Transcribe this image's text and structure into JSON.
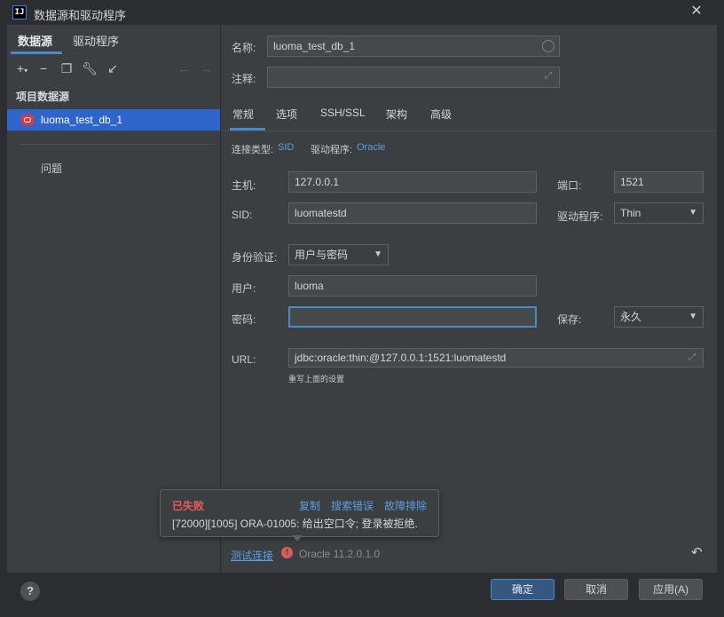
{
  "window": {
    "title": "数据源和驱动程序",
    "app_icon": "IJ"
  },
  "left_panel": {
    "tabs": [
      "数据源",
      "驱动程序"
    ],
    "section_title": "项目数据源",
    "datasource_item": "luoma_test_db_1",
    "problems": "问题"
  },
  "form": {
    "name_label": "名称:",
    "name_value": "luoma_test_db_1",
    "comment_label": "注释:",
    "comment_value": "",
    "tabs": [
      "常规",
      "选项",
      "SSH/SSL",
      "架构",
      "高级"
    ],
    "conn_type_label": "连接类型:",
    "conn_type_value": "SID",
    "driver_label": "驱动程序:",
    "driver_value": "Oracle",
    "host_label": "主机:",
    "host_value": "127.0.0.1",
    "port_label": "端口:",
    "port_value": "1521",
    "sid_label": "SID:",
    "sid_value": "luomatestd",
    "driver_select_label": "驱动程序:",
    "driver_select_value": "Thin",
    "auth_label": "身份验证:",
    "auth_value": "用户与密码",
    "user_label": "用户:",
    "user_value": "luoma",
    "password_label": "密码:",
    "password_value": "",
    "save_label": "保存:",
    "save_value": "永久",
    "url_label": "URL:",
    "url_value": "jdbc:oracle:thin:@127.0.0.1:1521:luomatestd",
    "url_hint": "重写上面的设置"
  },
  "popup": {
    "title": "已失败",
    "copy": "复制",
    "search": "搜索错误",
    "troubleshoot": "故障排除",
    "message": "[72000][1005] ORA-01005: 给出空口令; 登录被拒绝."
  },
  "footer": {
    "test_connection": "测试连接",
    "version": "Oracle 11.2.0.1.0",
    "ok": "确定",
    "cancel": "取消",
    "apply": "应用(A)",
    "help": "?"
  }
}
